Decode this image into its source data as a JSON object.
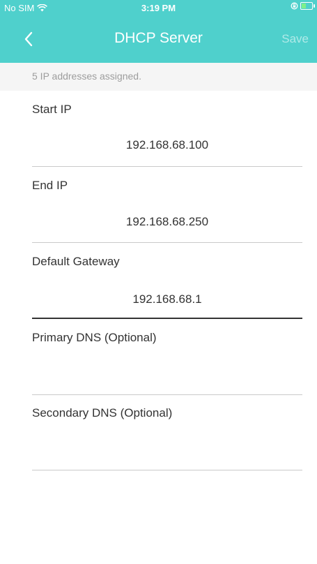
{
  "status_bar": {
    "carrier": "No SIM",
    "time": "3:19 PM",
    "wifi_icon": "wifi-icon",
    "battery_icon": "battery-icon",
    "lock_icon": "orientation-lock-icon"
  },
  "nav": {
    "title": "DHCP Server",
    "save_label": "Save",
    "back_icon": "chevron-left-icon"
  },
  "info": {
    "text": "5 IP addresses assigned."
  },
  "fields": [
    {
      "label": "Start IP",
      "value": "192.168.68.100"
    },
    {
      "label": "End IP",
      "value": "192.168.68.250"
    },
    {
      "label": "Default Gateway",
      "value": "192.168.68.1"
    },
    {
      "label": "Primary DNS (Optional)",
      "value": ""
    },
    {
      "label": "Secondary DNS (Optional)",
      "value": ""
    }
  ],
  "colors": {
    "header": "#4fd0cc",
    "banner": "#f5f5f5",
    "text": "#333333",
    "muted": "#9d9d9d"
  }
}
